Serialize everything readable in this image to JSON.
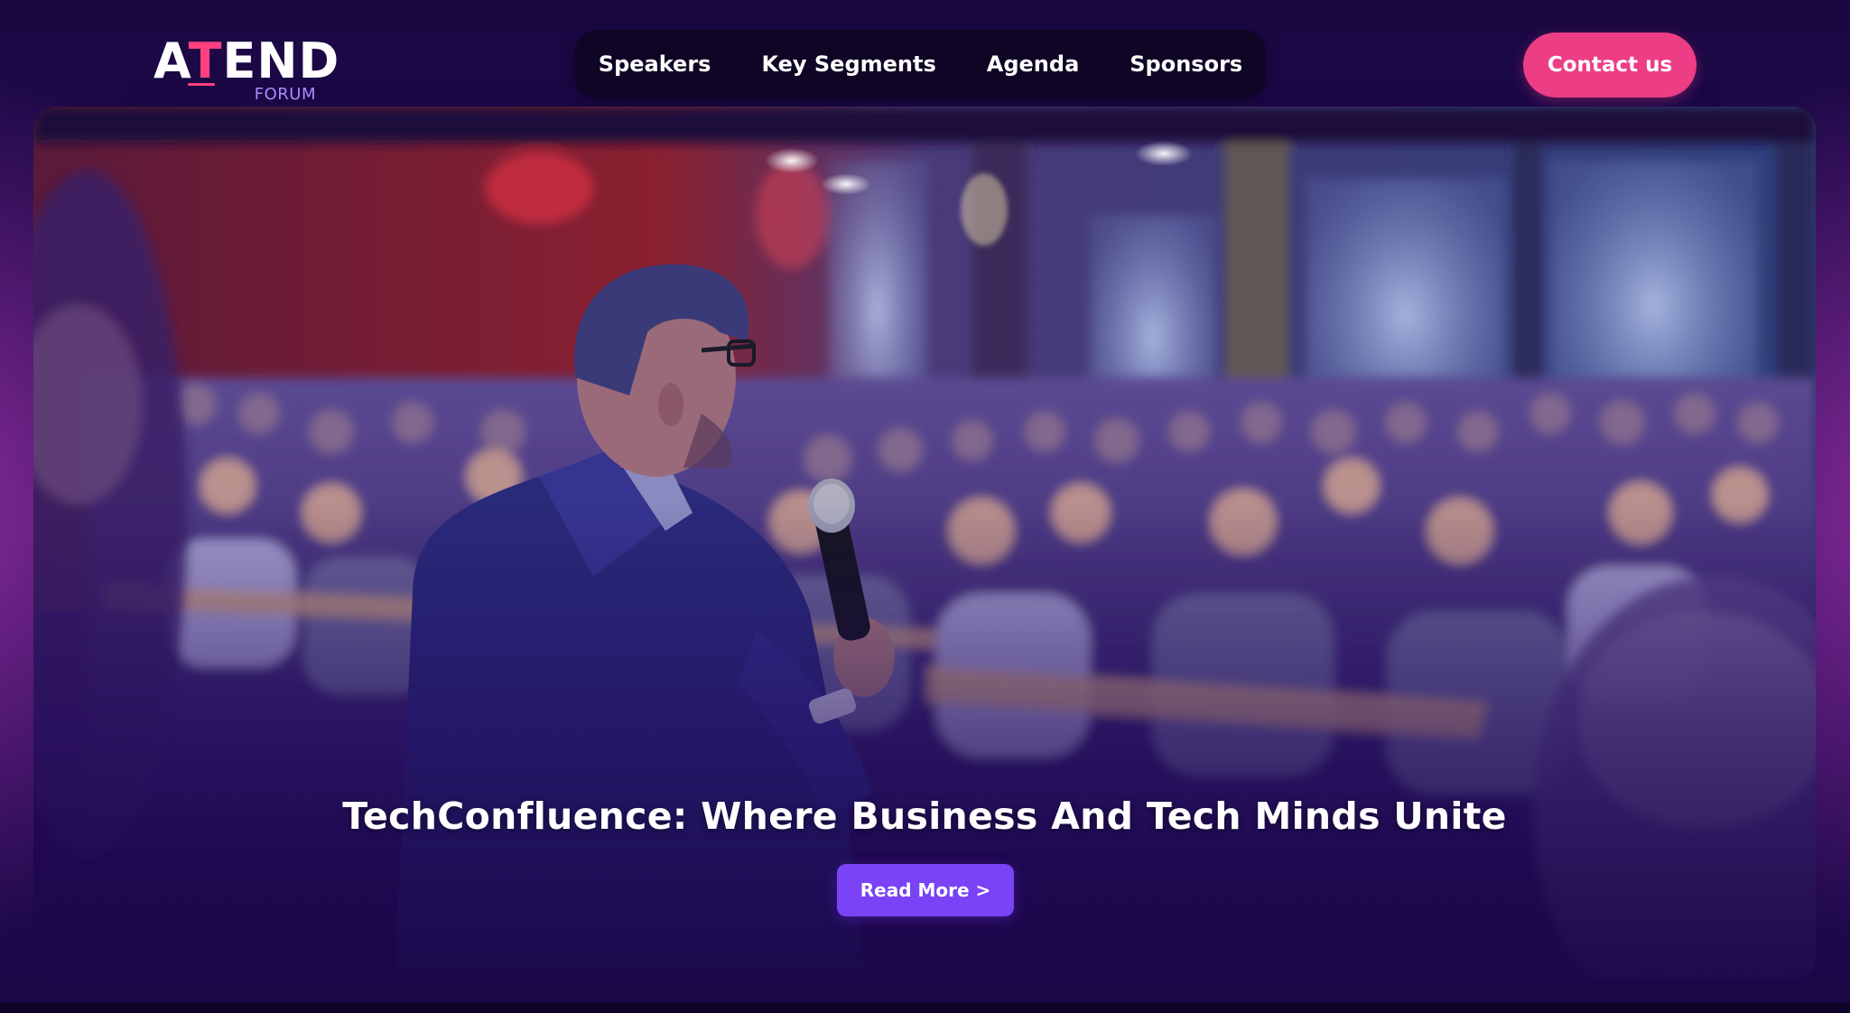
{
  "logo": {
    "word_pre": "A",
    "word_accent": "T",
    "word_post": "END",
    "sub": "FORUM"
  },
  "nav": {
    "items": [
      {
        "label": "Speakers"
      },
      {
        "label": "Key Segments"
      },
      {
        "label": "Agenda"
      },
      {
        "label": "Sponsors"
      }
    ]
  },
  "contact": {
    "label": "Contact us"
  },
  "hero": {
    "title": "TechConfluence: Where Business And Tech Minds Unite",
    "cta_label": "Read More >",
    "image": "conference-speaker-photo"
  },
  "colors": {
    "background": "#14063a",
    "accent_pink": "#ec3d85",
    "accent_purple": "#7a43f5",
    "nav_bg": "#0f0524"
  }
}
